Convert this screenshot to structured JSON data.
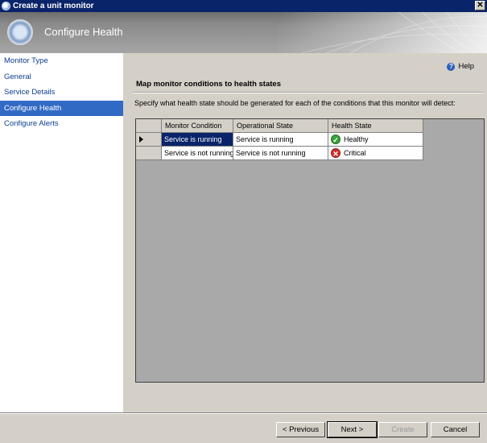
{
  "window": {
    "title": "Create a unit monitor"
  },
  "header": {
    "title": "Configure Health"
  },
  "nav": {
    "items": [
      {
        "label": "Monitor Type"
      },
      {
        "label": "General"
      },
      {
        "label": "Service Details"
      },
      {
        "label": "Configure Health",
        "active": true
      },
      {
        "label": "Configure Alerts"
      }
    ]
  },
  "content": {
    "help_label": "Help",
    "section_title": "Map monitor conditions to health states",
    "description": "Specify what health state should be generated for each of the conditions that this monitor will detect:"
  },
  "grid": {
    "columns": [
      "Monitor Condition",
      "Operational State",
      "Health State"
    ],
    "rows": [
      {
        "condition": "Service is running",
        "operational": "Service is running",
        "health": "Healthy",
        "icon": "healthy-check-icon",
        "selected": true
      },
      {
        "condition": "Service is not running",
        "operational": "Service is not running",
        "health": "Critical",
        "icon": "critical-x-icon",
        "selected": false
      }
    ]
  },
  "buttons": {
    "previous": "< Previous",
    "next": "Next >",
    "create": "Create",
    "cancel": "Cancel"
  },
  "colors": {
    "selection": "#0a246a",
    "nav_active": "#316ac5",
    "healthy": "#3aa33a",
    "critical": "#d32f2f"
  }
}
